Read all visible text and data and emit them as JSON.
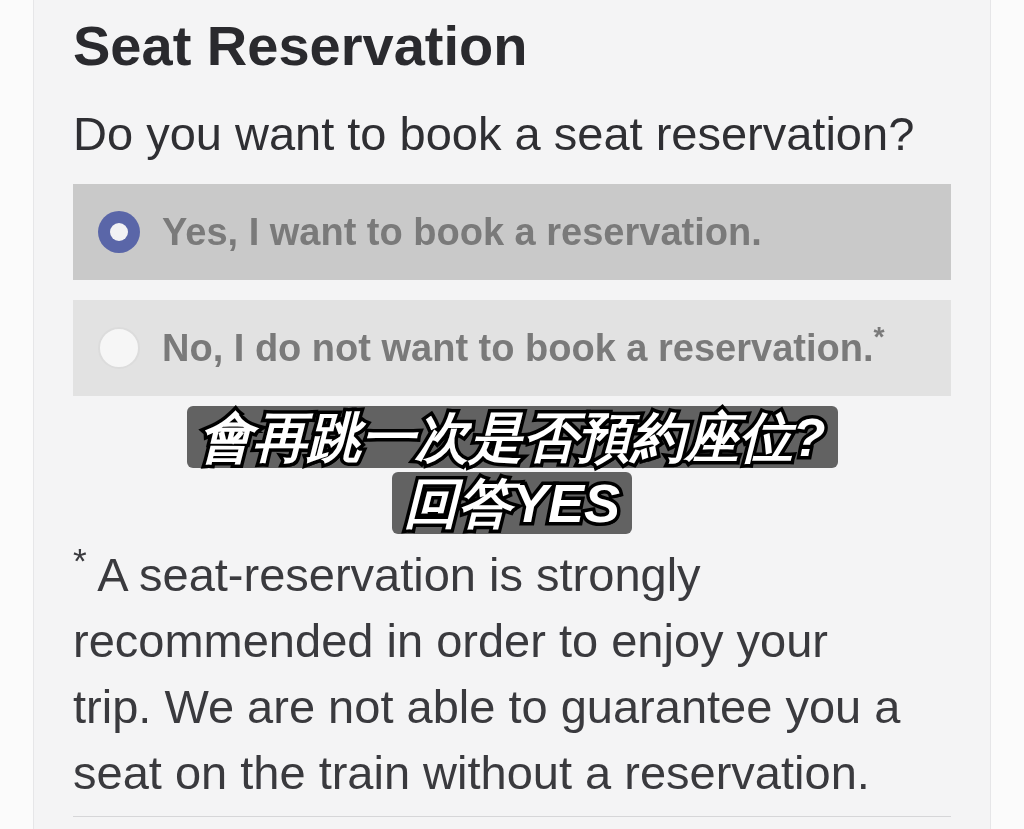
{
  "section": {
    "title": "Seat Reservation",
    "question": "Do you want to book a seat reservation?"
  },
  "options": [
    {
      "label": "Yes, I want to book a reservation.",
      "selected": true
    },
    {
      "label": "No, I do not want to book a reservation.$^{*}$",
      "selected": false
    }
  ],
  "caption": {
    "lines": [
      "會再跳一次是否預約座位?",
      "回答YES"
    ]
  },
  "footnote": "$^{*}$ A seat-reservation is strongly recommended in order to enjoy your trip. We are not able to guarantee you a seat on the train without a reservation."
}
